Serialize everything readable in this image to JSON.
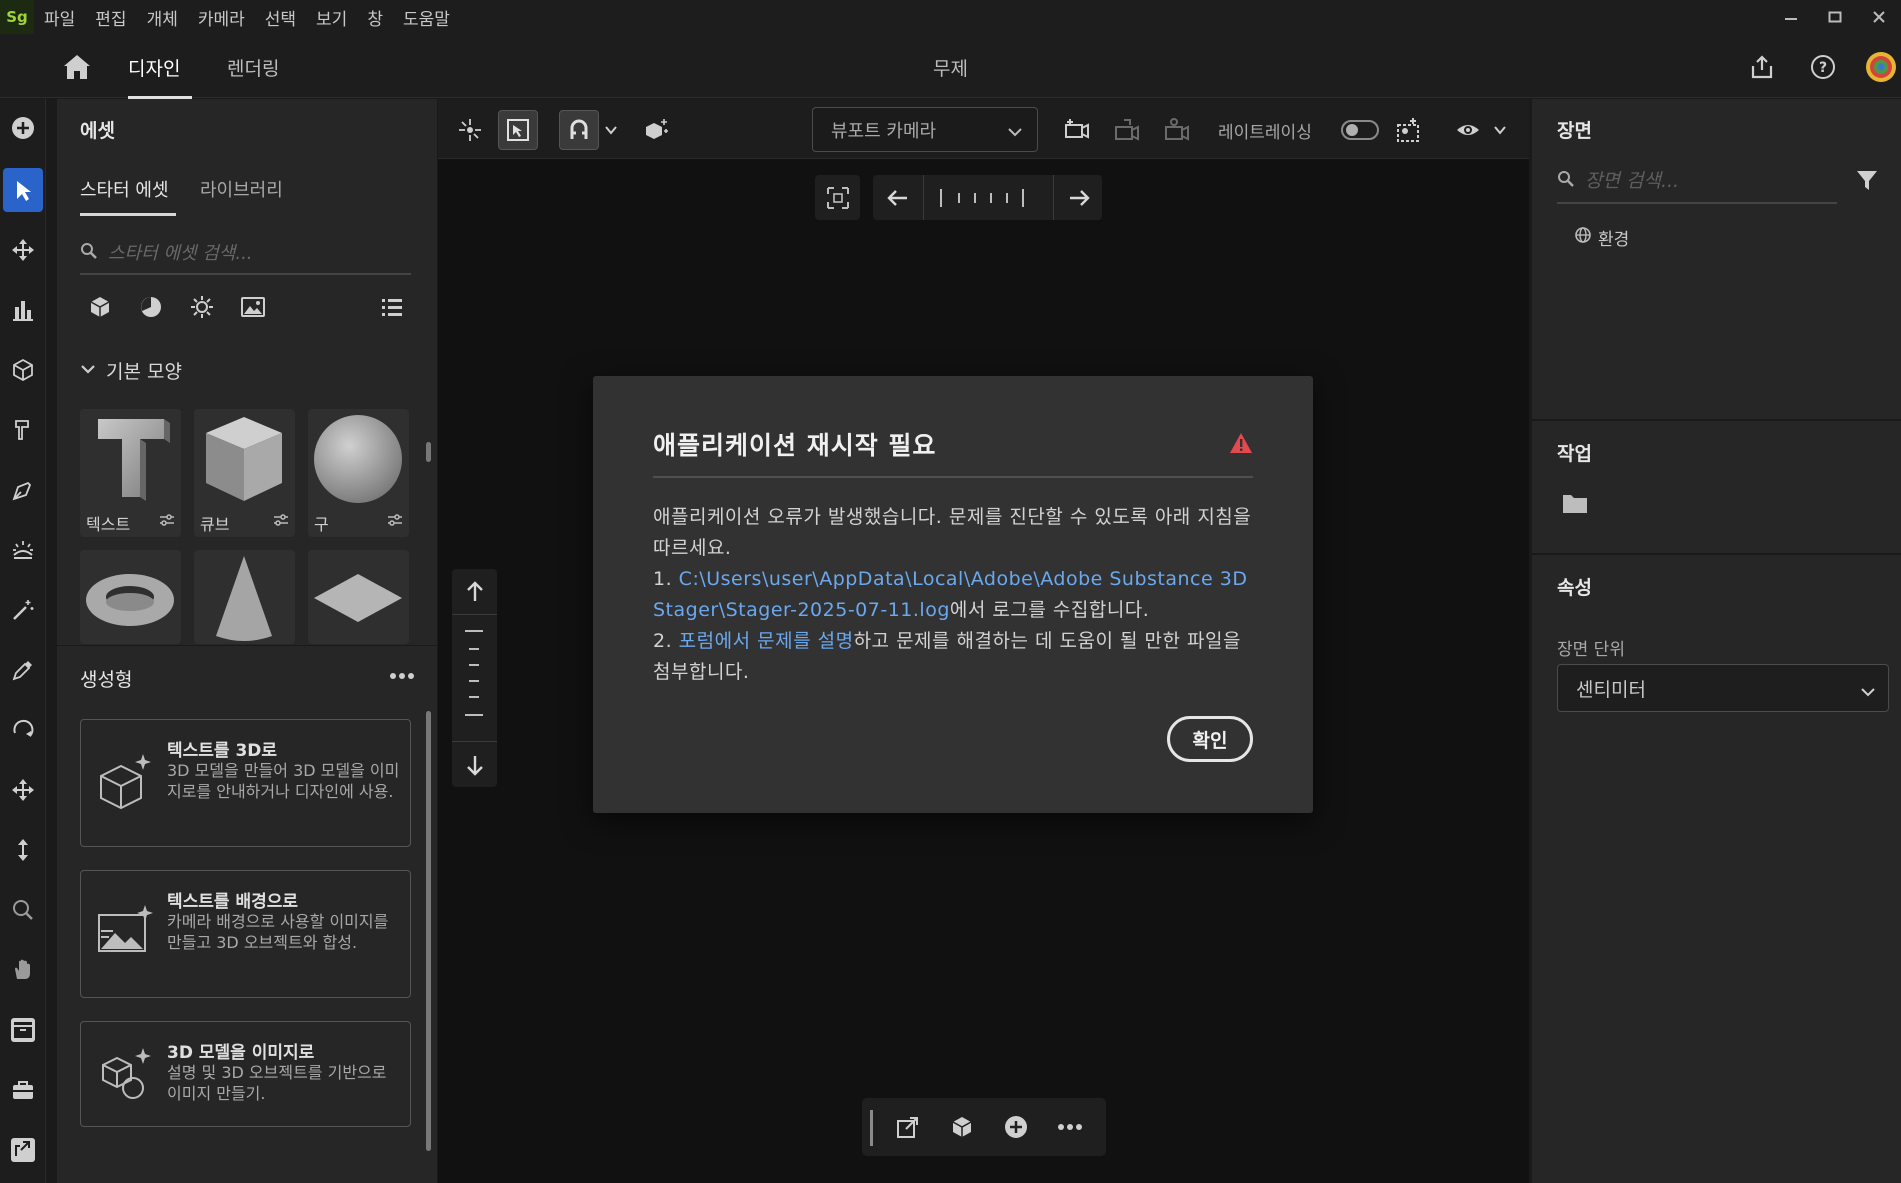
{
  "menubar": {
    "logo": "Sg",
    "items": [
      "파일",
      "편집",
      "개체",
      "카메라",
      "선택",
      "보기",
      "창",
      "도움말"
    ]
  },
  "header": {
    "tabs": [
      "디자인",
      "렌더링"
    ],
    "active_tab": "디자인",
    "document_title": "무제"
  },
  "assets": {
    "title": "에셋",
    "tabs": [
      "스타터 에셋",
      "라이브러리"
    ],
    "search_placeholder": "스타터 에셋 검색...",
    "section_title": "기본 모양",
    "shapes": [
      "텍스트",
      "큐브",
      "구"
    ],
    "generative": {
      "title": "생성형",
      "cards": [
        {
          "title": "텍스트를 3D로",
          "description": "3D 모델을 만들어 3D 모델을 이미지로를 안내하거나 디자인에 사용."
        },
        {
          "title": "텍스트를 배경으로",
          "description": "카메라 배경으로 사용할 이미지를 만들고 3D 오브젝트와 합성."
        },
        {
          "title": "3D 모델을 이미지로",
          "description": "설명 및 3D 오브젝트를 기반으로 이미지 만들기."
        }
      ]
    }
  },
  "viewport": {
    "camera_select": "뷰포트 카메라",
    "raytracing_label": "레이트레이싱",
    "raytracing_on": false
  },
  "dialog": {
    "title": "애플리케이션 재시작 필요",
    "intro": "애플리케이션 오류가 발생했습니다. 문제를 진단할 수 있도록 아래 지침을 따르세요.",
    "step1_prefix": "1. ",
    "step1_link": "C:\\Users\\user\\AppData\\Local\\Adobe\\Adobe Substance 3D Stager\\Stager-2025-07-11.log",
    "step1_suffix": "에서 로그를 수집합니다.",
    "step2_prefix": "2. ",
    "step2_link": "포럼에서 문제를 설명",
    "step2_suffix": "하고 문제를 해결하는 데 도움이 될 만한 파일을 첨부합니다.",
    "ok_label": "확인"
  },
  "right_panel": {
    "scene_title": "장면",
    "scene_search_placeholder": "장면 검색...",
    "environment_item": "환경",
    "actions_title": "작업",
    "properties_title": "속성",
    "scene_unit_label": "장면 단위",
    "scene_unit_value": "센티미터"
  },
  "colors": {
    "accent": "#2a63c9",
    "link": "#6aa8ef",
    "warning": "#e5484d",
    "logo": "#9fd33a"
  }
}
